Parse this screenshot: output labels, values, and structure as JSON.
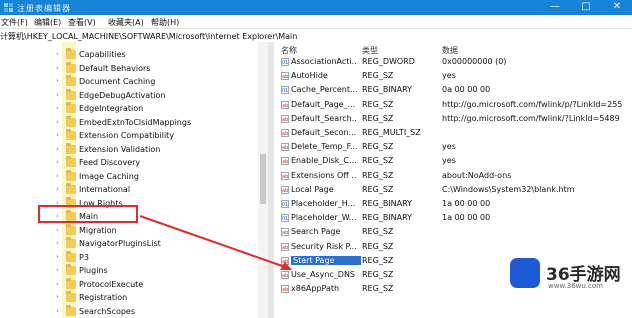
{
  "window": {
    "title": "注册表编辑器",
    "controls": [
      "—",
      "□",
      "✕"
    ]
  },
  "menu": [
    "文件(F)",
    "编辑(E)",
    "查看(V)",
    "收藏夹(A)",
    "帮助(H)"
  ],
  "address": "计算机\\HKEY_LOCAL_MACHINE\\SOFTWARE\\Microsoft\\Internet Explorer\\Main",
  "tree": {
    "items": [
      "Capabilities",
      "Default Behaviors",
      "Document Caching",
      "EdgeDebugActivation",
      "EdgeIntegration",
      "EmbedExtnToClsidMappings",
      "Extension Compatibility",
      "Extension Validation",
      "Feed Discovery",
      "Image Caching",
      "International",
      "Low Rights",
      "Main",
      "Migration",
      "NavigatorPluginsList",
      "P3",
      "Plugins",
      "ProtocolExecute",
      "Registration",
      "SearchScopes"
    ],
    "selected": "Main"
  },
  "values": {
    "columns": {
      "name": "名称",
      "type": "类型",
      "data": "数据"
    },
    "rows": [
      {
        "name": "AssociationActi...",
        "type": "REG_DWORD",
        "data": "0x00000000 (0)",
        "icon": "binary"
      },
      {
        "name": "AutoHide",
        "type": "REG_SZ",
        "data": "yes",
        "icon": "string"
      },
      {
        "name": "Cache_Percent...",
        "type": "REG_BINARY",
        "data": "0a 00 00 00",
        "icon": "binary"
      },
      {
        "name": "Default_Page_...",
        "type": "REG_SZ",
        "data": "http://go.microsoft.com/fwlink/p/?LinkId=255",
        "icon": "string"
      },
      {
        "name": "Default_Search...",
        "type": "REG_SZ",
        "data": "http://go.microsoft.com/fwlink/?LinkId=5489",
        "icon": "string"
      },
      {
        "name": "Default_Secon...",
        "type": "REG_MULTI_SZ",
        "data": "",
        "icon": "string"
      },
      {
        "name": "Delete_Temp_F...",
        "type": "REG_SZ",
        "data": "yes",
        "icon": "string"
      },
      {
        "name": "Enable_Disk_C...",
        "type": "REG_SZ",
        "data": "yes",
        "icon": "string"
      },
      {
        "name": "Extensions Off ...",
        "type": "REG_SZ",
        "data": "about:NoAdd-ons",
        "icon": "string"
      },
      {
        "name": "Local Page",
        "type": "REG_SZ",
        "data": "C:\\Windows\\System32\\blank.htm",
        "icon": "string"
      },
      {
        "name": "Placeholder_H...",
        "type": "REG_BINARY",
        "data": "1a 00 00 00",
        "icon": "binary"
      },
      {
        "name": "Placeholder_W...",
        "type": "REG_BINARY",
        "data": "1a 00 00 00",
        "icon": "binary"
      },
      {
        "name": "Search Page",
        "type": "REG_SZ",
        "data": "",
        "icon": "string"
      },
      {
        "name": "Security Risk P...",
        "type": "REG_SZ",
        "data": "",
        "icon": "string"
      },
      {
        "name": "Start Page",
        "type": "REG_SZ",
        "data": "",
        "icon": "string"
      },
      {
        "name": "Use_Async_DNS",
        "type": "REG_SZ",
        "data": "",
        "icon": "string"
      },
      {
        "name": "x86AppPath",
        "type": "REG_SZ",
        "data": "",
        "icon": "string"
      }
    ],
    "selected": "Start Page"
  },
  "watermark": {
    "brand": "36手游网",
    "url": "www.36wu.com"
  },
  "colors": {
    "titlebar": "#1683d8",
    "annotation": "#e22b2b",
    "selection": "#2b6fd0",
    "logo": "#1f5ad6"
  }
}
